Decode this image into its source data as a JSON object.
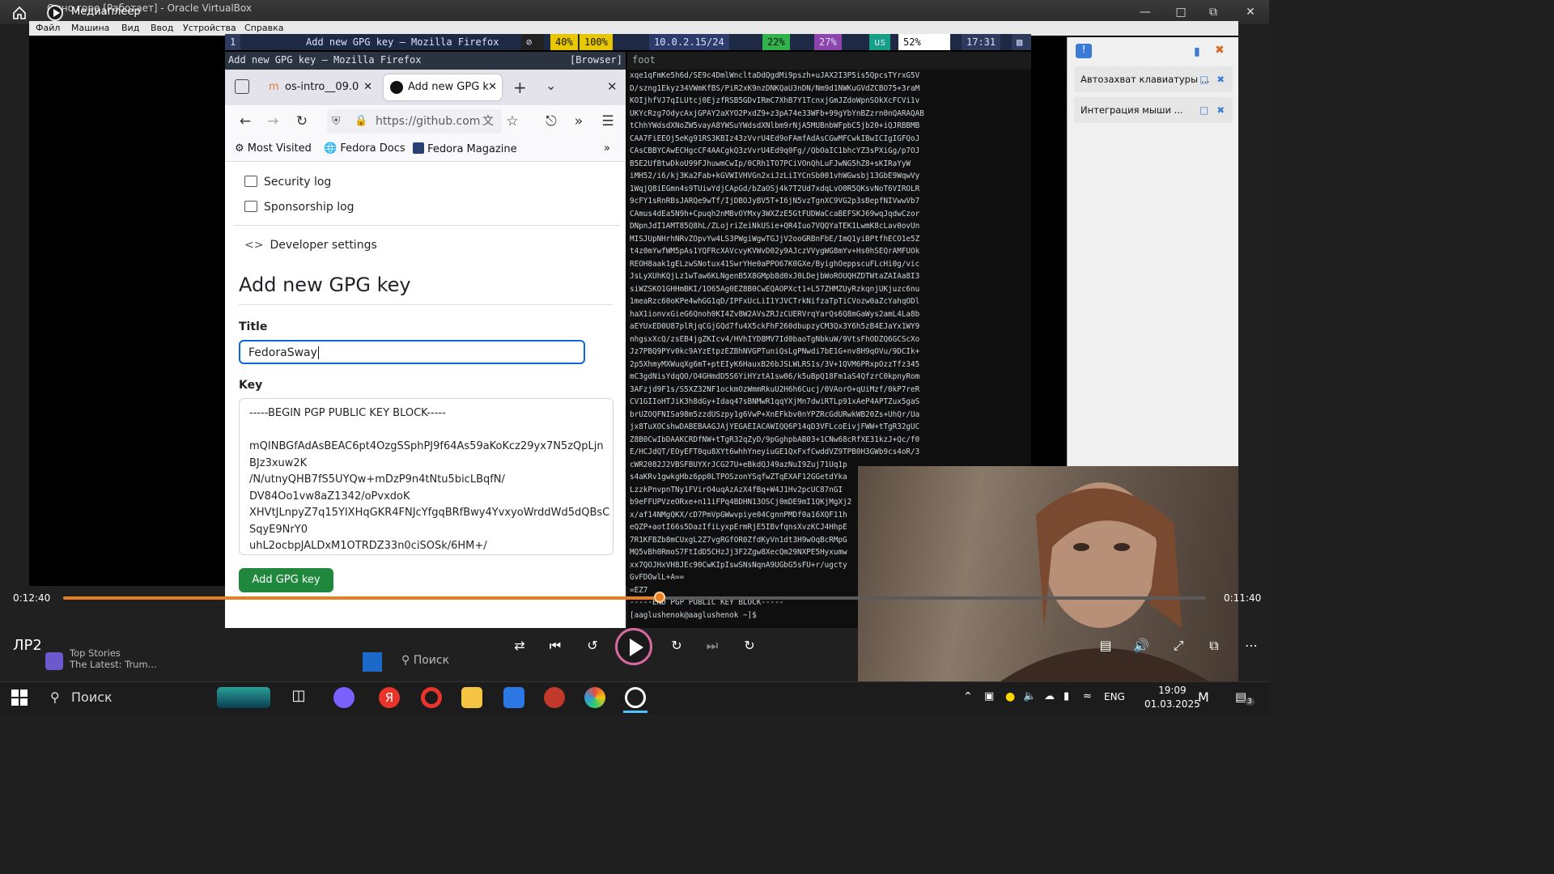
{
  "media_player": {
    "window_title": "Медиаплеер",
    "background_window_title": "Одно горе [Работает] - Oracle VirtualBox",
    "media_name": "ЛР2",
    "time_current": "0:12:40",
    "time_remaining": "0:11:40",
    "progress_fraction": 0.522
  },
  "vbox_menu": [
    "Файл",
    "Машина",
    "Вид",
    "Ввод",
    "Устройства",
    "Справка"
  ],
  "vbox_panel": {
    "items": [
      "Автозахват клавиатуры ...",
      "Интеграция мыши ..."
    ]
  },
  "swaybar": {
    "workspace": "1",
    "window": "Add new GPG key — Mozilla Firefox",
    "volume": "40%",
    "brightness": "100%",
    "ip": "10.0.2.15/24",
    "cpu": "22%",
    "mem": "27%",
    "layout": "us",
    "battery": "52%",
    "time": "17:31"
  },
  "browser": {
    "header_title": "Add new GPG key — Mozilla Firefox",
    "header_tag": "[Browser]",
    "tabs": [
      {
        "label": "os-intro__09.0"
      },
      {
        "label": "Add new GPG k"
      }
    ],
    "url": "https://github.com",
    "bookmarks": [
      "Most Visited",
      "Fedora Docs",
      "Fedora Magazine"
    ]
  },
  "page": {
    "menu_items": [
      "Security log",
      "Sponsorship log",
      "Developer settings"
    ],
    "heading": "Add new GPG key",
    "title_label": "Title",
    "title_value": "FedoraSway",
    "key_label": "Key",
    "key_lines": [
      "-----BEGIN PGP PUBLIC KEY BLOCK-----",
      "",
      "mQINBGfAdAsBEAC6pt4OzgSSphPJ9f64As59aKoKcz29yx7N5zQpLjn",
      "BJz3xuw2K",
      "/N/utnyQHB7fS5UYQw+mDzP9n4tNtu5bicLBqfN/",
      "DV84Oo1vw8aZ1342/oPvxdoK",
      "XHVtJLnpyZ7q15YIXHqGKR4FNJcYfgqBRfBwy4YvxyoWrddWd5dQBsC",
      "SqyE9NrY0",
      "uhL2ocbpJALDxM1OTRDZ33n0ciSOSk/6HM+/"
    ],
    "add_button": "Add GPG key"
  },
  "terminal": {
    "header": "foot",
    "lines": [
      "xqe1qFmKe5h6d/SE9c4DmlWncltaDdQgdMi9pszh+uJAX2I3P5is5QpcsTYrxG5V",
      "D/szng1Ekyz34VWmKfBS/PiR2xK9nzDNKQaU3nDN/Nm9d1NWKuGVdZCBO75+3raM",
      "KOIjhfVJ7qILUtcj0EjzfRSB5GDvIRmC7XhB7Y1TcnxjGmJZdoWpnSOkXcFCVi1v",
      "UKYcRzg7OdycAxjGPAY2aXYO2PxdZ9+z3pA74e33WFb+99gYbYnBZzrn0nQARAQAB",
      "tChhYWdsdXNoZW5vayA8YWSuYWdsdXNlbm9rNjA5MUBnbWFpbC5jb20+iQJRBBMB",
      "CAA7FiEEOj5eKg91RS3KBIz43zVvrU4Ed9oFAmfAdAsCGwMFCwkIBwICIgIGFQoJ",
      "CAsCBBYCAwECHgcCF4AACgkQ3zVvrU4Ed9q0Fg//QbOaIC1bhcYZ3sPXiGg/p7OJ",
      "B5E2UfBtwDkoU99FJhuwmCwIp/0CRh1TO7PCiVOnQhLuFJwNG5hZ8+sKIRaYyW",
      "iMH52/i6/kj3Ka2Fab+kGVWIVHVGn2xiJzLiIYCnSb001vhWGwsbj13GbE9WqwVy",
      "1WqjQ8iEGmn4s9TUiwYdjCApGd/bZaOSj4k7T2Ud7xdqLvO0R5QKsvNoT6VIROLR",
      "9cFY1sRnRBsJARQe9wTf/IjDBOJyBV5T+I6jN5vzTgnXC9VG2p3sBepfNIVwwVb7",
      "CAmus4dEa5N9h+Cpuqh2nMBvOYMxy3WXZzE5GtFUDWaCcaBEFSKJ69wqJqdwCzor",
      "DNpnJdI1AMT85Q8hL/ZLojriZeiNkUSie+QR4Iuo7VQQYaTEK1LwmK8cLav0ovUn",
      "MISJUpNHrhNRvZOpvYw4LS3PWgiWgwTGJjV2ooGRBnFbE/ImQ1yiBPtfhECO1e5Z",
      "t4z0mYwfWM5pAs1YQFRcXAVcvyKVWvD02y9AJczVVygWG8mYv+Hs0hSEQrAMFUOk",
      "REOH8aak1gELzwSNotux41SwrYHe0aPPO67K0GXe/ByighOeppscuFLcHi0g/vic",
      "JsLyXUhKQjLz1wTaw6KLNgenB5X8GMpb8d0xJ0LDejbWoROUQHZDTWtaZAIAa8I3",
      "siWZSKO1GHHmBKI/1O65Ag0EZ8B0CwEQAOPXct1+L57ZHMZUyRzkqnjUKjuzc6nu",
      "1meaRzc60oKPe4whGG1qD/IPFxUcLiI1YJVCTrkNifzaTpTiCVozw0aZcYahqODl",
      "haX1ionvxGieG6Qnoh0KI4Zv8W2AVsZRJzCUERVrqYarQs6Q8mGaWys2amL4La8b",
      "aEYUxED0U87plRjqCGjGQd7fu4X5ckFhF260dbupzyCM3Qx3Y6h5zB4EJaYx1WY9",
      "nhgsxXcQ/zsEB4jgZKIcv4/HVhIYD8MV7Id0baoTgNbkuW/9VtsFhODZQ6GCScXo",
      "Jz7PBQ9PYv0kc9AYzEtpzEZBhNVGPTuniQsLgPNwdi7bE1G+nv8H9qOVu/9DCIk+",
      "2p5XhmyMXWuqXg6mT+ptEIyK6HauxB26bJSLWLRS1s/3V+1QVM6PRxpOzzTfz345",
      "mC3gdNisYdqQO/O4GHmdD5S6YiHYztA1sw06/k5uBpQ18Fm1aS4QfzrC0kpnyRom",
      "3AFzjd9F1s/S5XZ32NF1ockmOzWmmRkuU2H6h6Cucj/0VAorO+qUiMzf/0kP7reR",
      "CV1GIIoHTJiK3h8dGy+Idaq47sBNMwR1qqYXjMn7dwiRTLp91xAeP4APTZux5gaS",
      "brUZOQFNISa98m5zzdUSzpy1g6VwP+XnEFkbv0nYPZRcGdURwkWB20Zs+UhQr/Ua",
      "jx8TuXOCshwDABEBAAGJAjYEGAEIACAWIQQ6P14qD3VFLcoEivjFWW+tTgR32gUC",
      "Z8B0CwIbDAAKCRDfNW+tTgR32qZyD/9pGghpbAB03+1CNw68cRfXE31kzJ+Qc/f0",
      "E/HCJdQT/EOyEFT0qu8XYt6whhYneyiuGE1QxFxfCwddVZ9TPB0H3GWb9cs4oR/3",
      "cWR2082J2VBSFBUYXrJCG27U+eBkdQJ49azNuI9Zuj71Uq1p",
      "s4aKRv1gwkgHbz6pp0LTPOSzonYSqfwZTqEXAF12GGetdYka",
      "LzzkPnvpnTNy1FVirO4uqAzAzX4fBq+W4J1Hv2pcUC87nGI",
      "b9eFFUPVzeORxe+n11iFPq4BDHN13OSCj0mDE9mI1QKjMgXj2",
      "x/af14NMgQKX/cD7PmVpGWwvpiye04CgnnPMDf0a16XQF11h",
      "eQZP+aotI66s5DazIfiLyxpErmRjE5IBvfqnsXvzKCJ4HhpE",
      "7R1KFBZb8mCUxgL2Z7vgRGfOR0ZfdKyVn1dt3H9wOqBcRMpG",
      "MQ5vBh0RmoS7FtIdD5CHzJj3F2Zgw8XecQm29NXPE5Hyxumw",
      "xx7QOJHxVH8JEc90CwKIpIswSNsNqnA9UGbG5sFU+r/ugcty",
      "GvFDOwlL+A==",
      "=EZ7",
      "-----END PGP PUBLIC KEY BLOCK-----",
      "[aaglushenok@aaglushenok ~]$ "
    ]
  },
  "inner_taskbar": {
    "news_title": "Top Stories",
    "news_sub": "The Latest: Trum...",
    "search": "Поиск"
  },
  "taskbar": {
    "search": "Поиск",
    "lang": "ENG",
    "time": "19:09",
    "date": "01.03.2025",
    "notif_count": "3"
  }
}
